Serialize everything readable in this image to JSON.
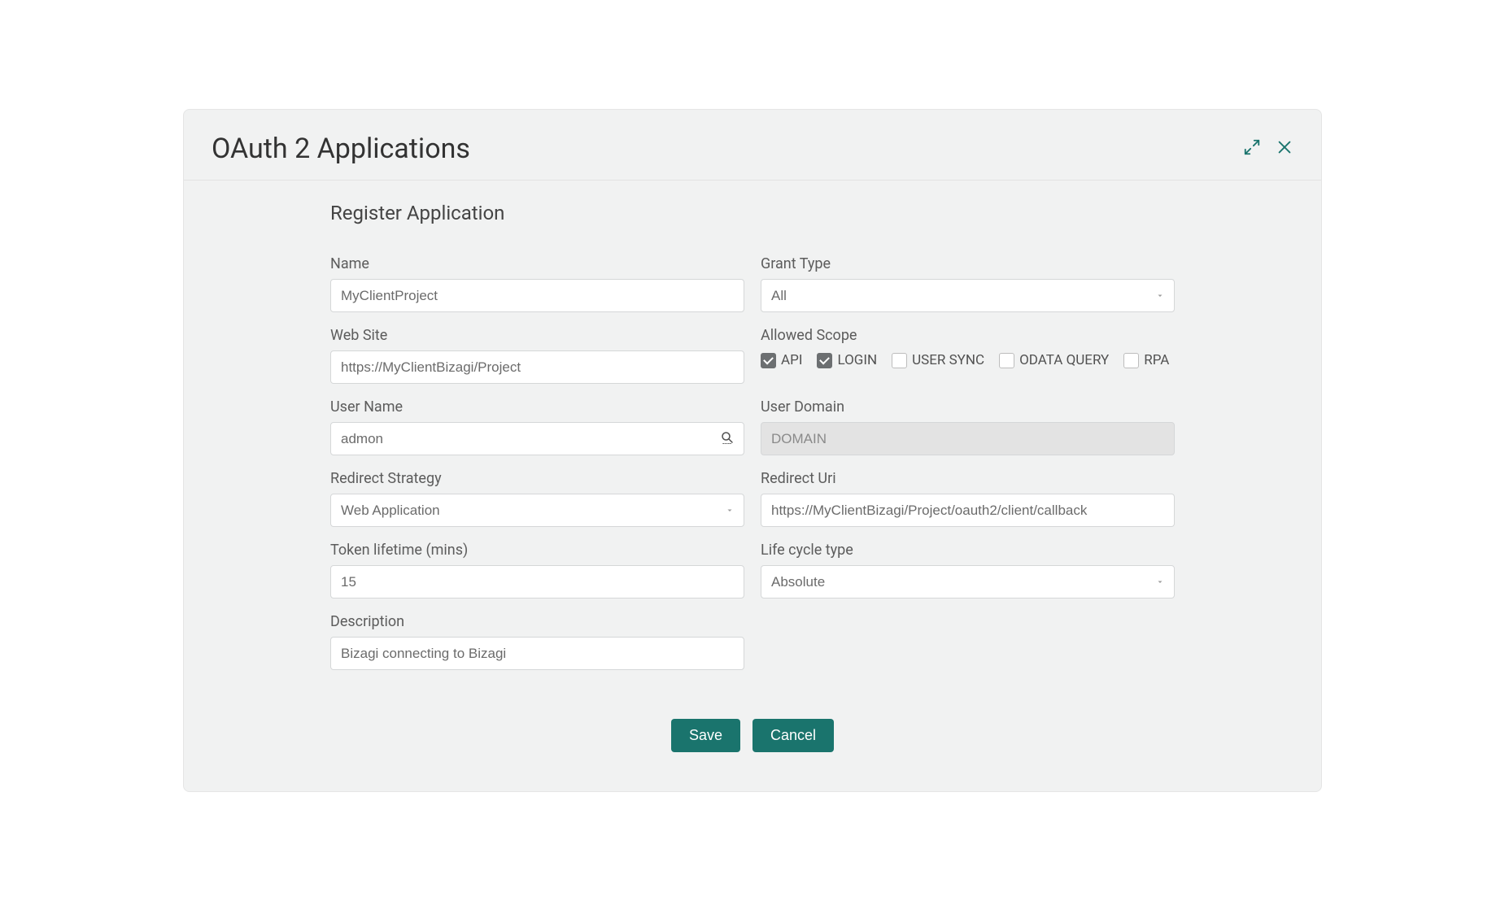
{
  "dialog": {
    "title": "OAuth 2 Applications",
    "section_title": "Register Application"
  },
  "fields": {
    "name_label": "Name",
    "name_value": "MyClientProject",
    "grant_type_label": "Grant Type",
    "grant_type_value": "All",
    "website_label": "Web Site",
    "website_value": "https://MyClientBizagi/Project",
    "allowed_scope_label": "Allowed Scope",
    "scopes": {
      "api": "API",
      "login": "LOGIN",
      "user_sync": "USER SYNC",
      "odata_query": "ODATA QUERY",
      "rpa": "RPA"
    },
    "username_label": "User Name",
    "username_value": "admon",
    "user_domain_label": "User Domain",
    "user_domain_value": "DOMAIN",
    "redirect_strategy_label": "Redirect Strategy",
    "redirect_strategy_value": "Web Application",
    "redirect_uri_label": "Redirect Uri",
    "redirect_uri_value": "https://MyClientBizagi/Project/oauth2/client/callback",
    "token_lifetime_label": "Token lifetime (mins)",
    "token_lifetime_value": "15",
    "life_cycle_type_label": "Life cycle type",
    "life_cycle_type_value": "Absolute",
    "description_label": "Description",
    "description_value": "Bizagi connecting to Bizagi"
  },
  "buttons": {
    "save": "Save",
    "cancel": "Cancel"
  },
  "colors": {
    "accent": "#1a746d"
  }
}
